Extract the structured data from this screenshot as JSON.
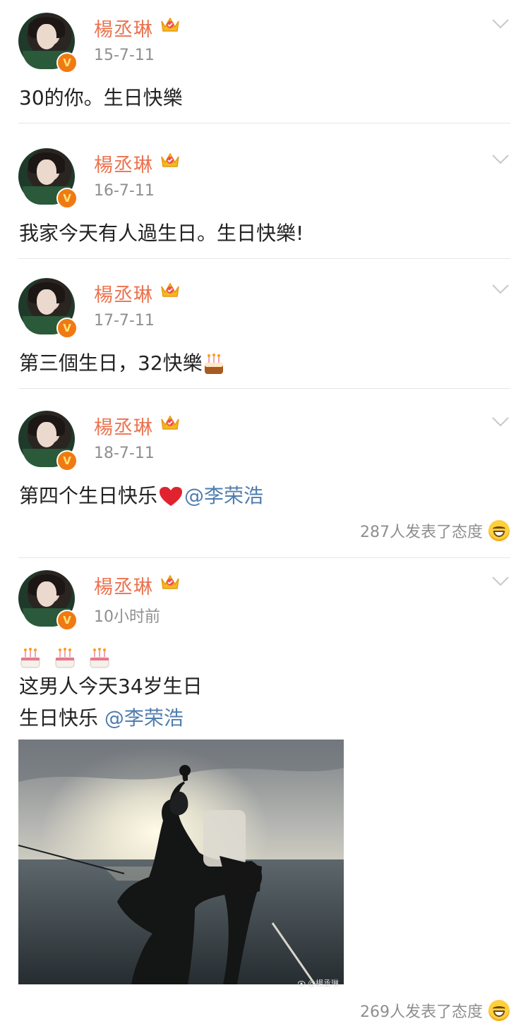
{
  "posts": [
    {
      "name": "楊丞琳",
      "time": "15-7-11",
      "text": "30的你。生日快樂"
    },
    {
      "name": "楊丞琳",
      "time": "16-7-11",
      "text": "我家今天有人過生日。生日快樂!"
    },
    {
      "name": "楊丞琳",
      "time": "17-7-11",
      "text": "第三個生日，32快樂"
    },
    {
      "name": "楊丞琳",
      "time": "18-7-11",
      "text": "第四个生日快乐",
      "mention": "@李荣浩",
      "reactions": "287人发表了态度"
    },
    {
      "name": "楊丞琳",
      "time": "10小时前",
      "line2": "这男人今天34岁生日",
      "line3": "生日快乐 ",
      "mention": "@李荣浩",
      "reactions": "269人发表了态度",
      "photo_watermark": "@楊丞琳"
    }
  ],
  "icons": {
    "verified": "v-badge-icon",
    "member": "crown-icon",
    "menu": "chevron-down-icon",
    "cake": "birthday-cake-emoji",
    "heart": "red-heart-emoji",
    "react": "grinning-face-icon"
  },
  "colors": {
    "name": "#eb7350",
    "mention": "#507daf",
    "badge": "#f07a12",
    "meta": "#8f8f8f"
  }
}
